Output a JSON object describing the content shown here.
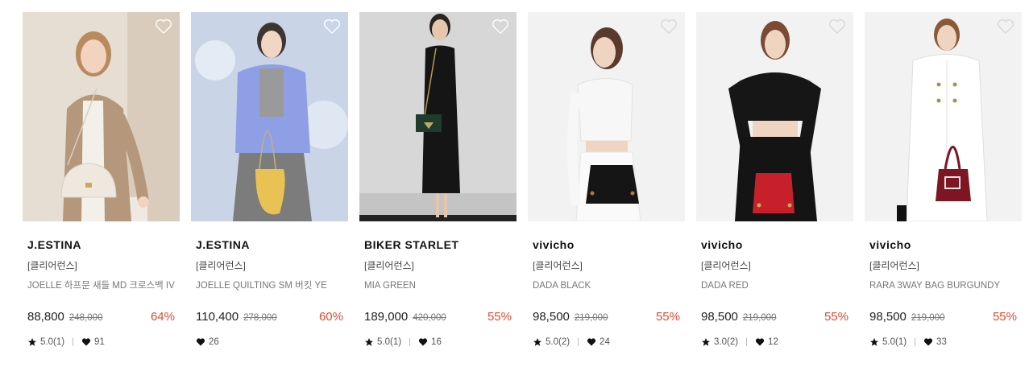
{
  "products": [
    {
      "brand": "J.ESTINA",
      "tag": "[클리어런스]",
      "name": "JOELLE 하프문 새들 MD 크로스백 IV",
      "price": "88,800",
      "original_price": "248,000",
      "discount": "64%",
      "rating": "5.0(1)",
      "likes": "91",
      "has_rating": true
    },
    {
      "brand": "J.ESTINA",
      "tag": "[클리어런스]",
      "name": "JOELLE QUILTING SM 버킷 YE",
      "price": "110,400",
      "original_price": "278,000",
      "discount": "60%",
      "rating": "",
      "likes": "26",
      "has_rating": false
    },
    {
      "brand": "BIKER STARLET",
      "tag": "[클리어런스]",
      "name": "MIA GREEN",
      "price": "189,000",
      "original_price": "420,000",
      "discount": "55%",
      "rating": "5.0(1)",
      "likes": "16",
      "has_rating": true
    },
    {
      "brand": "vivicho",
      "tag": "[클리어런스]",
      "name": "DADA BLACK",
      "price": "98,500",
      "original_price": "219,000",
      "discount": "55%",
      "rating": "5.0(2)",
      "likes": "24",
      "has_rating": true
    },
    {
      "brand": "vivicho",
      "tag": "[클리어런스]",
      "name": "DADA RED",
      "price": "98,500",
      "original_price": "219,000",
      "discount": "55%",
      "rating": "3.0(2)",
      "likes": "12",
      "has_rating": true
    },
    {
      "brand": "vivicho",
      "tag": "[클리어런스]",
      "name": "RARA 3WAY BAG BURGUNDY",
      "price": "98,500",
      "original_price": "219,000",
      "discount": "55%",
      "rating": "5.0(1)",
      "likes": "33",
      "has_rating": true
    }
  ],
  "colors": {
    "discount": "#e8472f",
    "text": "#222222",
    "muted": "#777777"
  },
  "icons": {
    "wishlist": "heart-outline-icon",
    "rating": "star-icon",
    "likes": "heart-filled-icon"
  }
}
